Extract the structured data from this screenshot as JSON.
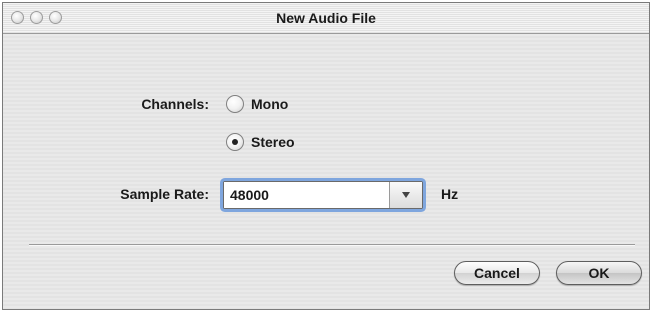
{
  "window": {
    "title": "New Audio File"
  },
  "channels": {
    "label": "Channels:",
    "options": [
      {
        "label": "Mono",
        "selected": false
      },
      {
        "label": "Stereo",
        "selected": true
      }
    ]
  },
  "sample_rate": {
    "label": "Sample Rate:",
    "value": "48000",
    "unit": "Hz"
  },
  "buttons": {
    "cancel": "Cancel",
    "ok": "OK"
  }
}
